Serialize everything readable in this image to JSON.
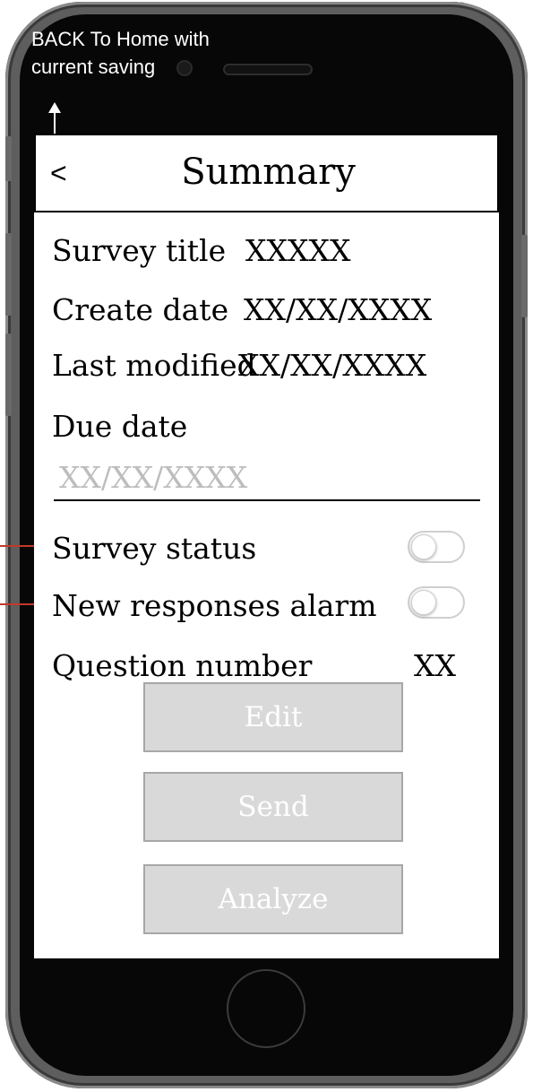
{
  "annotation": {
    "text": "BACK To Home with current saving"
  },
  "header": {
    "back_label": "<",
    "title": "Summary"
  },
  "fields": {
    "survey_title": {
      "label": "Survey title",
      "value": "XXXXX"
    },
    "create_date": {
      "label": "Create date",
      "value": "XX/XX/XXXX"
    },
    "last_modified": {
      "label": "Last modified",
      "value": "XX/XX/XXXX"
    },
    "due_date": {
      "label": "Due date",
      "placeholder": "XX/XX/XXXX"
    },
    "survey_status": {
      "label": "Survey status",
      "on": false
    },
    "new_responses_alarm": {
      "label": "New responses alarm",
      "on": false
    },
    "question_number": {
      "label": "Question number",
      "value": "XX"
    }
  },
  "buttons": {
    "edit": "Edit",
    "send": "Send",
    "analyze": "Analyze"
  },
  "colors": {
    "button_bg": "#d9d9d9",
    "button_text": "#ffffff",
    "placeholder": "#bdbdbd",
    "pointer_line": "#c0392b"
  }
}
